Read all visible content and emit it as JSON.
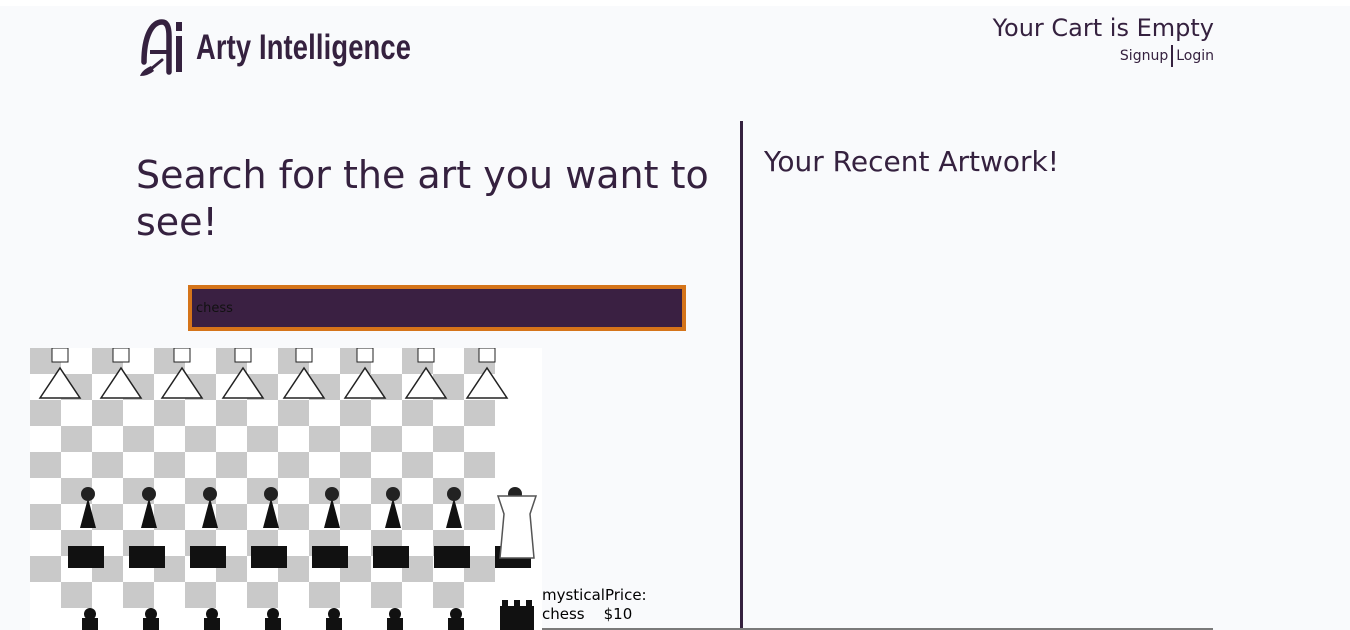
{
  "header": {
    "logo_text": "Arty Intelligence",
    "cart_status": "Your Cart is Empty",
    "signup_label": "Signup",
    "login_label": "Login"
  },
  "search": {
    "heading": "Search for the art you want to see!",
    "value": "chess"
  },
  "result": {
    "caption_line1": "mysticalPrice:",
    "title": "chess",
    "price": "$10"
  },
  "recent": {
    "heading": "Your Recent Artwork!"
  },
  "colors": {
    "primary": "#35213f",
    "accent": "#d5741a",
    "input_bg": "#3a2042",
    "background": "#f9fafc"
  },
  "icons": [
    "logo-ai-brush-icon"
  ]
}
